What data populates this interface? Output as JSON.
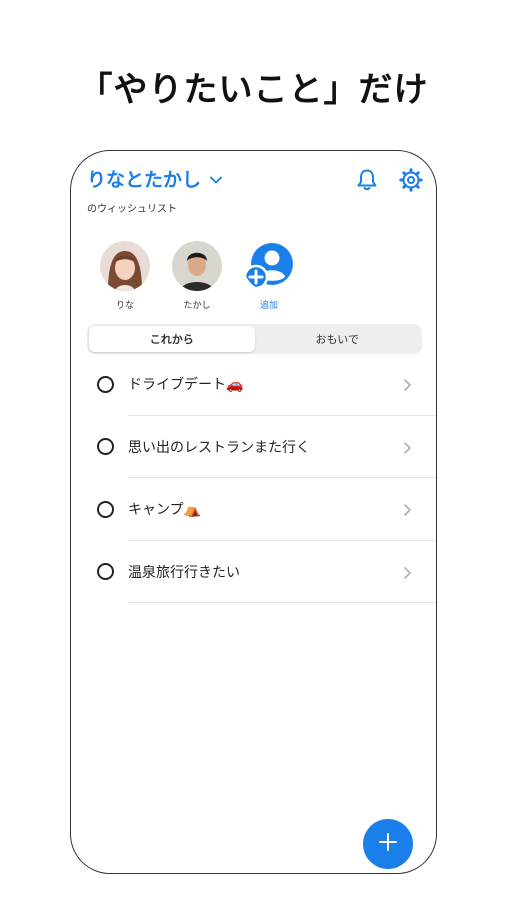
{
  "headline": "「やりたいこと」だけ",
  "header": {
    "title": "りなとたかし",
    "subtitle": "のウィッシュリスト",
    "icons": [
      "bell-icon",
      "gear-icon",
      "chevron-down-icon"
    ]
  },
  "members": [
    {
      "label": "りな"
    },
    {
      "label": "たかし"
    },
    {
      "label": "追加"
    }
  ],
  "tabs": [
    {
      "label": "これから",
      "active": true
    },
    {
      "label": "おもいで",
      "active": false
    }
  ],
  "items": [
    {
      "text": "ドライブデート🚗"
    },
    {
      "text": "思い出のレストランまた行く"
    },
    {
      "text": "キャンプ⛺"
    },
    {
      "text": "温泉旅行行きたい"
    }
  ],
  "accent_color": "#1a7fe8"
}
